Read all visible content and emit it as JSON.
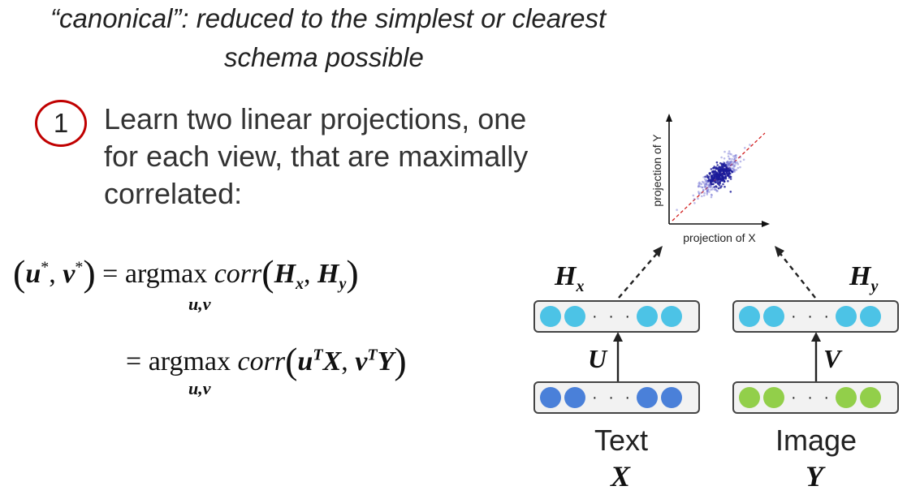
{
  "header": {
    "line1": "“canonical”: reduced to the simplest or clearest",
    "line2": "schema possible"
  },
  "step": {
    "number": "1",
    "line1": "Learn two linear projections, one",
    "line2": "for each view, that are maximally",
    "line3": "correlated:"
  },
  "equations": {
    "lhs": "(u*, v*) =",
    "argmax": "argmax",
    "under": "u,v",
    "corr": "corr",
    "eq2": "="
  },
  "diagram": {
    "hx_label": "H",
    "hx_sub": "x",
    "hy_label": "H",
    "hy_sub": "y",
    "u_label": "U",
    "v_label": "V",
    "text_caption": "Text",
    "text_var": "X",
    "image_caption": "Image",
    "image_var": "Y",
    "dots": "· · ·",
    "colors": {
      "projected": "#4cc3e6",
      "text_input": "#4a80d9",
      "image_input": "#92cf4a",
      "circle": "#c00000"
    }
  },
  "scatter": {
    "xlabel": "projection of X",
    "ylabel": "projection of Y"
  }
}
